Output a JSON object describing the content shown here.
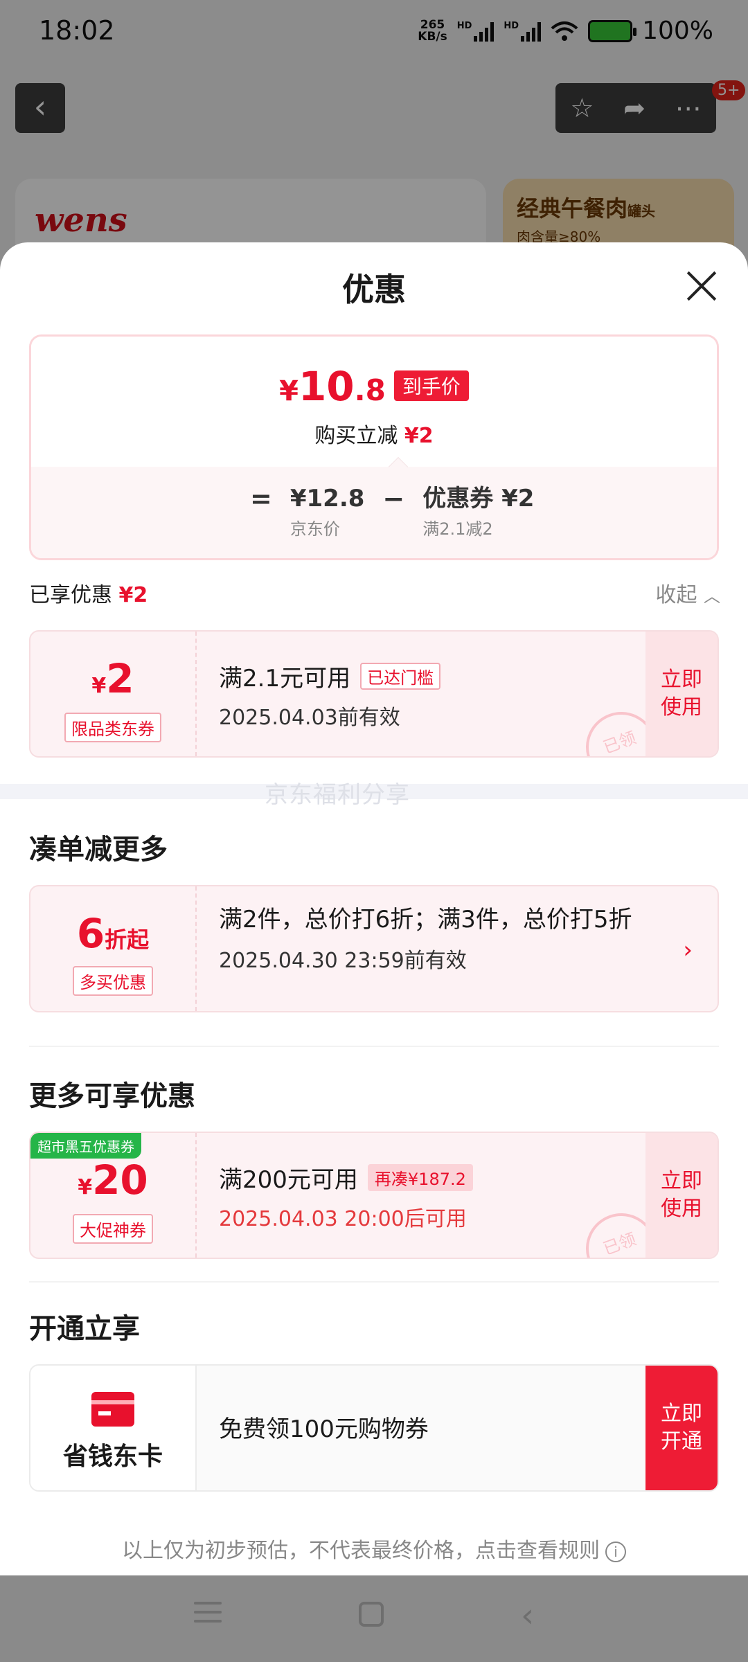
{
  "status_bar": {
    "time": "18:02",
    "net_speed_top": "265",
    "net_speed_unit": "KB/s",
    "hd1": "HD",
    "hd2": "HD",
    "battery": "100%"
  },
  "background": {
    "back_icon": "chevron-left-icon",
    "action_icons": [
      "star-icon",
      "share-icon",
      "more-icon"
    ],
    "badge": "5+",
    "brand": "wens",
    "promo_title": "经典午餐肉",
    "promo_suffix": "罐头",
    "promo_sub": "肉含量≥80%"
  },
  "sheet": {
    "title": "优惠",
    "price": {
      "symbol": "¥",
      "integer": "10",
      "decimal": ".8",
      "tag": "到手价",
      "sub_label": "购买立减",
      "sub_value": "¥2",
      "eq": "=",
      "minus": "−",
      "jd_price": "¥12.8",
      "jd_price_label": "京东价",
      "coupon_term": "优惠券 ¥2",
      "coupon_term_label": "满2.1减2"
    },
    "enjoyed": {
      "label": "已享优惠",
      "value": "¥2",
      "collapse": "收起"
    },
    "coupon1": {
      "symbol": "¥",
      "amount": "2",
      "type": "限品类东券",
      "condition": "满2.1元可用",
      "pill": "已达门槛",
      "date": "2025.04.03前有效",
      "action": "立即使用",
      "stamp": "已领"
    },
    "watermark": "京东福利分享",
    "section_multi": "凑单减更多",
    "multi": {
      "amount": "6",
      "suffix": "折起",
      "type": "多买优惠",
      "condition": "满2件，总价打6折；满3件，总价打5折",
      "date": "2025.04.30 23:59前有效"
    },
    "section_more": "更多可享优惠",
    "coupon2": {
      "corner": "超市黑五优惠券",
      "symbol": "¥",
      "amount": "20",
      "type": "大促神券",
      "condition": "满200元可用",
      "pill": "再凑¥187.2",
      "date": "2025.04.03 20:00后可用",
      "action": "立即使用",
      "stamp": "已领"
    },
    "section_open": "开通立享",
    "card": {
      "name": "省钱东卡",
      "desc": "免费领100元购物券",
      "action": "立即开通"
    },
    "disclaimer": "以上仅为初步预估，不代表最终价格，点击查看规则",
    "accent": "#e8112d"
  }
}
